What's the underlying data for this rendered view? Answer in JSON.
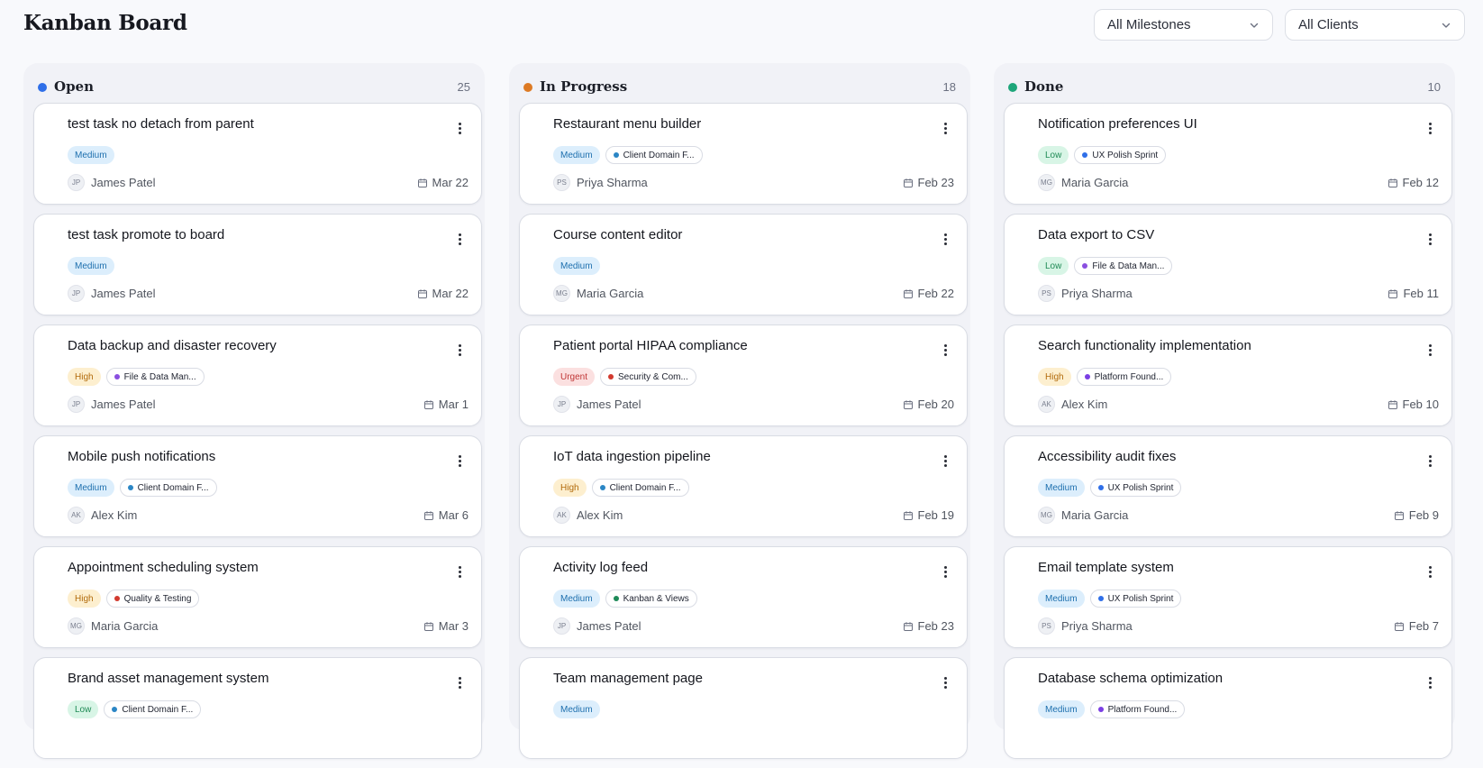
{
  "header": {
    "title": "Kanban Board",
    "milestone_filter": "All Milestones",
    "client_filter": "All Clients"
  },
  "icons": {
    "chevron": "chevron-down-icon",
    "menu": "more-vertical-icon",
    "calendar": "calendar-icon"
  },
  "colors": {
    "open": "#2f6fe8",
    "in_progress": "#dd7a24",
    "done": "#1ea67a",
    "milestone_client_domain": "#2b86c5",
    "milestone_file_data": "#8a4fe0",
    "milestone_security": "#d23a2f",
    "milestone_quality": "#d23a2f",
    "milestone_kanban": "#1e8a58",
    "milestone_ux": "#2f6fe8",
    "milestone_platform": "#7b3fe4"
  },
  "columns": [
    {
      "title": "Open",
      "count": "25",
      "dot": "#2f6fe8",
      "cards": [
        {
          "title": "test task no detach from parent",
          "priority": "Medium",
          "milestone": "",
          "milestone_color": "",
          "initials": "JP",
          "assignee": "James Patel",
          "due": "Mar 22"
        },
        {
          "title": "test task promote to board",
          "priority": "Medium",
          "milestone": "",
          "milestone_color": "",
          "initials": "JP",
          "assignee": "James Patel",
          "due": "Mar 22"
        },
        {
          "title": "Data backup and disaster recovery",
          "priority": "High",
          "milestone": "File & Data Man...",
          "milestone_color": "#8a4fe0",
          "initials": "JP",
          "assignee": "James Patel",
          "due": "Mar 1"
        },
        {
          "title": "Mobile push notifications",
          "priority": "Medium",
          "milestone": "Client Domain F...",
          "milestone_color": "#2b86c5",
          "initials": "AK",
          "assignee": "Alex Kim",
          "due": "Mar 6"
        },
        {
          "title": "Appointment scheduling system",
          "priority": "High",
          "milestone": "Quality & Testing",
          "milestone_color": "#d23a2f",
          "initials": "MG",
          "assignee": "Maria Garcia",
          "due": "Mar 3"
        },
        {
          "title": "Brand asset management system",
          "priority": "Low",
          "milestone": "Client Domain F...",
          "milestone_color": "#2b86c5",
          "initials": "",
          "assignee": "",
          "due": ""
        }
      ]
    },
    {
      "title": "In Progress",
      "count": "18",
      "dot": "#dd7a24",
      "cards": [
        {
          "title": "Restaurant menu builder",
          "priority": "Medium",
          "milestone": "Client Domain F...",
          "milestone_color": "#2b86c5",
          "initials": "PS",
          "assignee": "Priya Sharma",
          "due": "Feb 23"
        },
        {
          "title": "Course content editor",
          "priority": "Medium",
          "milestone": "",
          "milestone_color": "",
          "initials": "MG",
          "assignee": "Maria Garcia",
          "due": "Feb 22"
        },
        {
          "title": "Patient portal HIPAA compliance",
          "priority": "Urgent",
          "milestone": "Security & Com...",
          "milestone_color": "#d23a2f",
          "initials": "JP",
          "assignee": "James Patel",
          "due": "Feb 20"
        },
        {
          "title": "IoT data ingestion pipeline",
          "priority": "High",
          "milestone": "Client Domain F...",
          "milestone_color": "#2b86c5",
          "initials": "AK",
          "assignee": "Alex Kim",
          "due": "Feb 19"
        },
        {
          "title": "Activity log feed",
          "priority": "Medium",
          "milestone": "Kanban & Views",
          "milestone_color": "#1e8a58",
          "initials": "JP",
          "assignee": "James Patel",
          "due": "Feb 23"
        },
        {
          "title": "Team management page",
          "priority": "Medium",
          "milestone": "",
          "milestone_color": "",
          "initials": "",
          "assignee": "",
          "due": ""
        }
      ]
    },
    {
      "title": "Done",
      "count": "10",
      "dot": "#1ea67a",
      "cards": [
        {
          "title": "Notification preferences UI",
          "priority": "Low",
          "milestone": "UX Polish Sprint",
          "milestone_color": "#2f6fe8",
          "initials": "MG",
          "assignee": "Maria Garcia",
          "due": "Feb 12"
        },
        {
          "title": "Data export to CSV",
          "priority": "Low",
          "milestone": "File & Data Man...",
          "milestone_color": "#8a4fe0",
          "initials": "PS",
          "assignee": "Priya Sharma",
          "due": "Feb 11"
        },
        {
          "title": "Search functionality implementation",
          "priority": "High",
          "milestone": "Platform Found...",
          "milestone_color": "#7b3fe4",
          "initials": "AK",
          "assignee": "Alex Kim",
          "due": "Feb 10"
        },
        {
          "title": "Accessibility audit fixes",
          "priority": "Medium",
          "milestone": "UX Polish Sprint",
          "milestone_color": "#2f6fe8",
          "initials": "MG",
          "assignee": "Maria Garcia",
          "due": "Feb 9"
        },
        {
          "title": "Email template system",
          "priority": "Medium",
          "milestone": "UX Polish Sprint",
          "milestone_color": "#2f6fe8",
          "initials": "PS",
          "assignee": "Priya Sharma",
          "due": "Feb 7"
        },
        {
          "title": "Database schema optimization",
          "priority": "Medium",
          "milestone": "Platform Found...",
          "milestone_color": "#7b3fe4",
          "initials": "",
          "assignee": "",
          "due": ""
        }
      ]
    }
  ]
}
